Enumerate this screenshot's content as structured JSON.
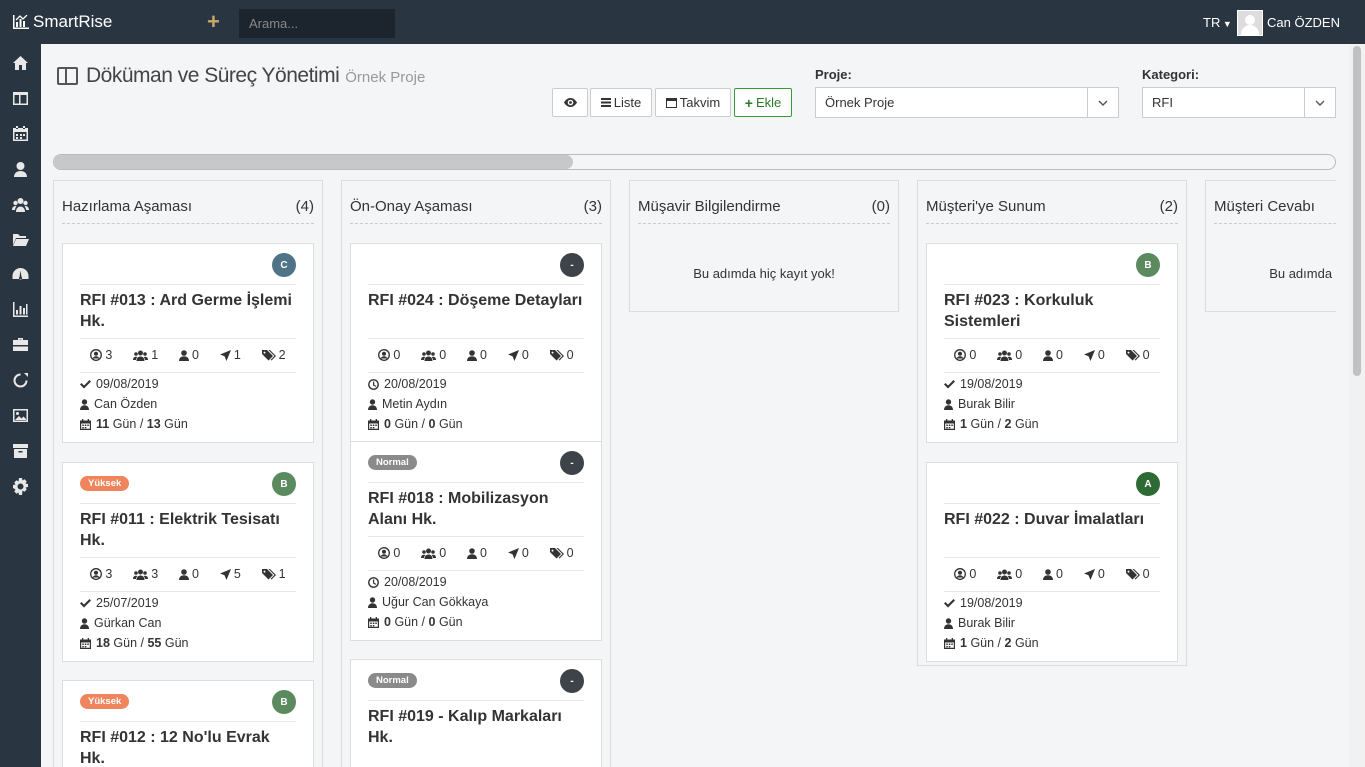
{
  "app": {
    "name": "SmartRise"
  },
  "header": {
    "search_placeholder": "Arama...",
    "language": "TR",
    "user_name": "Can ÖZDEN"
  },
  "page": {
    "title": "Döküman ve Süreç Yönetimi",
    "subtitle": "Örnek Proje"
  },
  "toolbar": {
    "list_label": "Liste",
    "calendar_label": "Takvim",
    "add_label": "Ekle"
  },
  "filters": {
    "project_label": "Proje:",
    "project_value": "Örnek Proje",
    "category_label": "Kategori:",
    "category_value": "RFI"
  },
  "progress": {
    "fraction": 0.405
  },
  "colors": {
    "topbar": "#2a3542",
    "green_badge": "#5b8a5e",
    "dark_green_badge": "#2e6b34",
    "teal_badge": "#4f7488",
    "dark_badge": "#3d4348",
    "priority_high": "#f0845c",
    "priority_normal": "#8a8a8a"
  },
  "columns": [
    {
      "title": "Hazırlama Aşaması",
      "count": "(4)",
      "empty_text": "",
      "cards": [
        {
          "letter": "C",
          "letter_color": "#4f7488",
          "priority": "",
          "title": "RFI #013 : Ard Germe İşlemi Hk.",
          "stats": [
            "3",
            "1",
            "0",
            "1",
            "2"
          ],
          "date_icon": "check",
          "date": "09/08/2019",
          "person": "Can Özden",
          "days_a": "11",
          "days_a_unit": "Gün",
          "days_b": "13",
          "days_b_unit": "Gün"
        },
        {
          "letter": "B",
          "letter_color": "#5b8a5e",
          "priority": "Yüksek",
          "title": "RFI #011 : Elektrik Tesisatı Hk.",
          "stats": [
            "3",
            "3",
            "0",
            "5",
            "1"
          ],
          "date_icon": "check",
          "date": "25/07/2019",
          "person": "Gürkan Can",
          "days_a": "18",
          "days_a_unit": "Gün",
          "days_b": "55",
          "days_b_unit": "Gün"
        },
        {
          "letter": "B",
          "letter_color": "#5b8a5e",
          "priority": "Yüksek",
          "title": "RFI #012 : 12 No'lu Evrak Hk.",
          "stats": [],
          "date_icon": "",
          "date": "",
          "person": "",
          "days_a": "",
          "days_a_unit": "",
          "days_b": "",
          "days_b_unit": ""
        }
      ]
    },
    {
      "title": "Ön-Onay Aşaması",
      "count": "(3)",
      "empty_text": "",
      "cards": [
        {
          "letter": "-",
          "letter_color": "#3d4348",
          "priority": "",
          "title": "RFI #024 : Döşeme Detayları",
          "stats": [
            "0",
            "0",
            "0",
            "0",
            "0"
          ],
          "date_icon": "clock",
          "date": "20/08/2019",
          "person": "Metin Aydın",
          "days_a": "0",
          "days_a_unit": "Gün",
          "days_b": "0",
          "days_b_unit": "Gün"
        },
        {
          "letter": "-",
          "letter_color": "#3d4348",
          "priority": "Normal",
          "title": "RFI #018 : Mobilizasyon Alanı Hk.",
          "stats": [
            "0",
            "0",
            "0",
            "0",
            "0"
          ],
          "date_icon": "clock",
          "date": "20/08/2019",
          "person": "Uğur Can Gökkaya",
          "days_a": "0",
          "days_a_unit": "Gün",
          "days_b": "0",
          "days_b_unit": "Gün"
        },
        {
          "letter": "-",
          "letter_color": "#3d4348",
          "priority": "Normal",
          "title": "RFI #019 - Kalıp Markaları Hk.",
          "stats": [],
          "date_icon": "",
          "date": "",
          "person": "",
          "days_a": "",
          "days_a_unit": "",
          "days_b": "",
          "days_b_unit": ""
        }
      ]
    },
    {
      "title": "Müşavir Bilgilendirme",
      "count": "(0)",
      "empty_text": "Bu adımda hiç kayıt yok!",
      "cards": []
    },
    {
      "title": "Müşteri'ye Sunum",
      "count": "(2)",
      "empty_text": "",
      "cards": [
        {
          "letter": "B",
          "letter_color": "#5b8a5e",
          "priority": "",
          "title": "RFI #023 : Korkuluk Sistemleri",
          "stats": [
            "0",
            "0",
            "0",
            "0",
            "0"
          ],
          "date_icon": "check",
          "date": "19/08/2019",
          "person": "Burak Bilir",
          "days_a": "1",
          "days_a_unit": "Gün",
          "days_b": "2",
          "days_b_unit": "Gün"
        },
        {
          "letter": "A",
          "letter_color": "#2e6b34",
          "priority": "",
          "title": "RFI #022 : Duvar İmalatları",
          "stats": [
            "0",
            "0",
            "0",
            "0",
            "0"
          ],
          "date_icon": "check",
          "date": "19/08/2019",
          "person": "Burak Bilir",
          "days_a": "1",
          "days_a_unit": "Gün",
          "days_b": "2",
          "days_b_unit": "Gün"
        }
      ]
    },
    {
      "title": "Müşteri Cevabı",
      "count": "",
      "empty_text": "Bu adımda hiç kayıt yok!",
      "cards": []
    }
  ],
  "sidebar": {
    "icons": [
      "home-icon",
      "columns-icon",
      "calendar-icon",
      "user-icon",
      "users-icon",
      "folder-open-icon",
      "dashboard-icon",
      "bar-chart-icon",
      "briefcase-icon",
      "circle-icon",
      "image-icon",
      "archive-icon",
      "settings-icon"
    ]
  }
}
